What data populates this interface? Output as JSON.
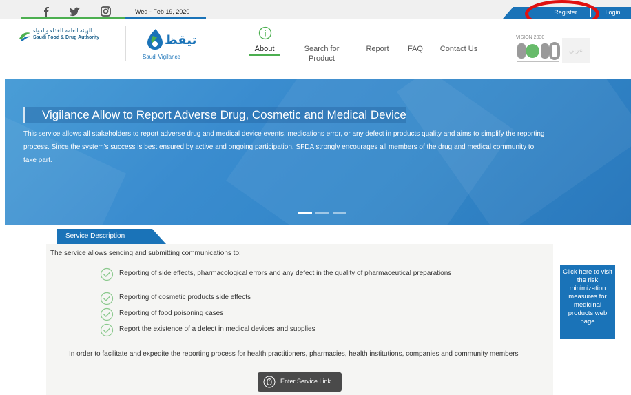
{
  "topbar": {
    "date": "Wed - Feb 19, 2020",
    "social_icons": [
      "facebook-icon",
      "twitter-icon",
      "instagram-icon"
    ],
    "register_label": "Register",
    "login_label": "Login"
  },
  "header": {
    "sfda_arabic": "الهيئة العامة للغذاء والدواء",
    "sfda_english": "Saudi Food & Drug Authority",
    "logo_arabic": "تيقظ",
    "logo_english": "Saudi Vigilance",
    "vision_text": "VISION 2030",
    "arabic_toggle": "عربي",
    "nav": [
      {
        "label": "About"
      },
      {
        "label": "Search for Product"
      },
      {
        "label": "Report"
      },
      {
        "label": "FAQ"
      },
      {
        "label": "Contact Us"
      }
    ]
  },
  "hero": {
    "title": "Vigilance Allow to Report Adverse Drug, Cosmetic and Medical Device",
    "text": "This service allows all stakeholders to report adverse drug and medical device events, medications error, or any defect in products quality and aims to simplify the reporting process. Since the system's success is best ensured by active and ongoing participation, SFDA strongly encourages all members of the drug and medical community to take part.",
    "active_slide": 1,
    "slide_count": 3
  },
  "service": {
    "tab_label": "Service Description",
    "intro": "The service allows sending and submitting communications to:",
    "items": [
      "Reporting of side effects, pharmacological errors and any defect in the quality of pharmaceutical preparations",
      "Reporting of cosmetic products side effects",
      "Reporting of food poisoning cases",
      "Report the existence of a defect in medical devices and supplies"
    ],
    "note": "In order to facilitate and expedite the reporting process for health practitioners, pharmacies, health institutions, companies and community members",
    "enter_label": "Enter Service Link"
  },
  "risk_button": {
    "label": "Click here to visit the risk minimization measures for medicinal products web page"
  },
  "colors": {
    "primary_blue": "#1a73b8",
    "accent_green": "#4caf50",
    "annotation_red": "#e01010"
  }
}
